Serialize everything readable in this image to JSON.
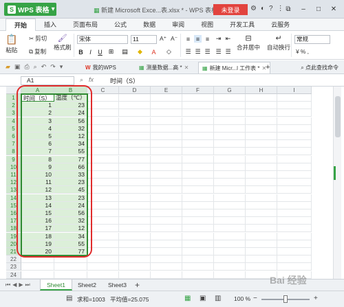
{
  "app": {
    "brand": "WPS 表格",
    "title": "新建 Microsoft Exce...表.xlsx * - WPS 表格",
    "login": "未登录",
    "window_controls": [
      "restore-icon",
      "minimize-icon",
      "maximize-icon",
      "close-icon"
    ]
  },
  "ribbon": {
    "tabs": [
      "开始",
      "插入",
      "页面布局",
      "公式",
      "数据",
      "审阅",
      "视图",
      "开发工具",
      "云服务"
    ],
    "active_tab": "开始",
    "clipboard": {
      "paste": "粘贴",
      "cut": "剪切",
      "copy": "复制",
      "format_painter": "格式刷"
    },
    "font_name": "宋体",
    "font_size": "11",
    "merge_center": "合并居中",
    "wrap_text": "自动换行",
    "number_format": "常规",
    "percent_label": "% ,"
  },
  "quick_access": {
    "doc_tabs": [
      {
        "label": "我的WPS",
        "active": false
      },
      {
        "label": "测量数据...高 *",
        "active": false
      },
      {
        "label": "新建 Micr...l 工作表 *",
        "active": true
      }
    ],
    "search": "点此查找命令"
  },
  "formula_bar": {
    "name_box": "A1",
    "fx_label": "fx",
    "content": "时间（S）"
  },
  "sheet": {
    "columns": [
      "A",
      "B",
      "C",
      "D",
      "E",
      "F",
      "G",
      "H",
      "I"
    ],
    "row_numbers": [
      "1",
      "2",
      "3",
      "4",
      "5",
      "6",
      "7",
      "8",
      "9",
      "10",
      "11",
      "12",
      "13",
      "14",
      "15",
      "16",
      "17",
      "18",
      "19",
      "20",
      "21",
      "22",
      "23",
      "24"
    ],
    "header_row": [
      "时间（S）",
      "温度（℃）"
    ],
    "data_rows": [
      [
        1,
        23
      ],
      [
        2,
        24
      ],
      [
        3,
        56
      ],
      [
        4,
        32
      ],
      [
        5,
        12
      ],
      [
        6,
        34
      ],
      [
        7,
        55
      ],
      [
        8,
        77
      ],
      [
        9,
        66
      ],
      [
        10,
        33
      ],
      [
        11,
        23
      ],
      [
        12,
        45
      ],
      [
        13,
        23
      ],
      [
        14,
        24
      ],
      [
        15,
        56
      ],
      [
        16,
        32
      ],
      [
        17,
        12
      ],
      [
        18,
        34
      ],
      [
        19,
        55
      ],
      [
        20,
        77
      ]
    ]
  },
  "sheet_tabs": [
    "Sheet1",
    "Sheet2",
    "Sheet3"
  ],
  "active_sheet": "Sheet1",
  "status_bar": {
    "sum": "求和=1003",
    "average": "平均值=25.075",
    "zoom": "100 %"
  },
  "watermark": "Bai 经验"
}
